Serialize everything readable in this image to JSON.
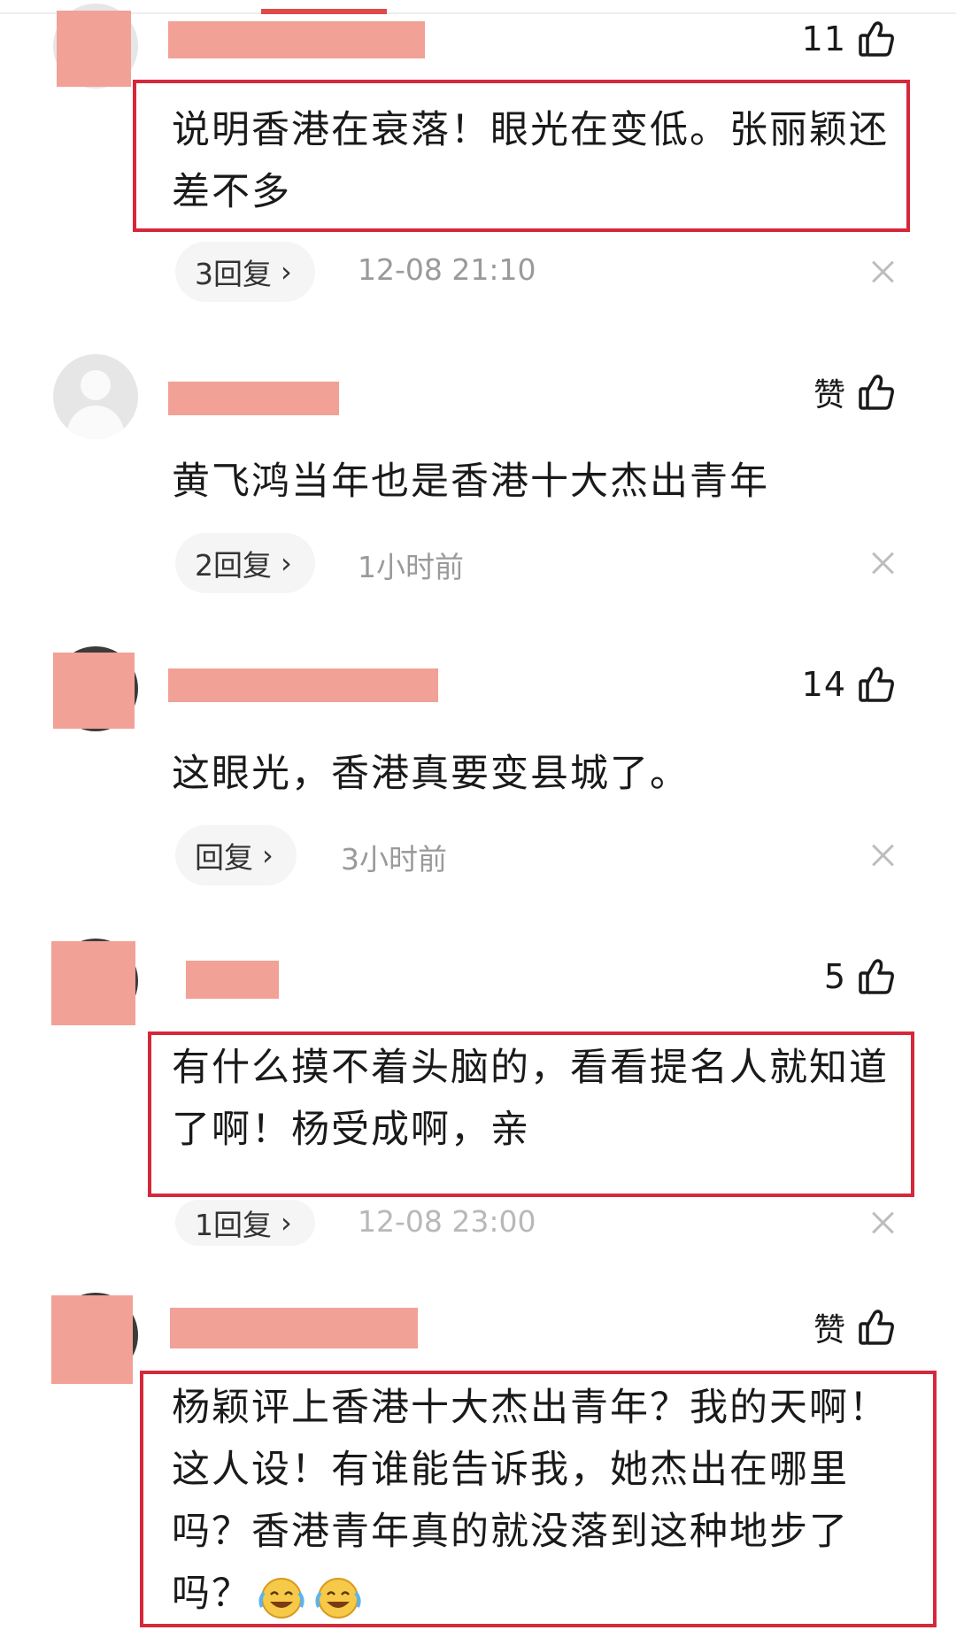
{
  "comments": [
    {
      "likes": "11",
      "text": "说明香港在衰落！眼光在变低。张丽颖还差不多",
      "reply_label": "3回复",
      "time": "12-08 21:10",
      "highlighted": true
    },
    {
      "likes": "赞",
      "text": "黄飞鸿当年也是香港十大杰出青年",
      "reply_label": "2回复",
      "time": "1小时前",
      "highlighted": false
    },
    {
      "likes": "14",
      "text": "这眼光，香港真要变县城了。",
      "reply_label": "回复",
      "time": "3小时前",
      "highlighted": false
    },
    {
      "likes": "5",
      "text": "有什么摸不着头脑的，看看提名人就知道了啊！杨受成啊，亲",
      "reply_label": "1回复",
      "time": "12-08 23:00",
      "highlighted": true
    },
    {
      "likes": "赞",
      "text": "杨颖评上香港十大杰出青年？我的天啊！这人设！有谁能告诉我，她杰出在哪里吗？香港青年真的就没落到这种地步了吗？",
      "highlighted": true
    }
  ],
  "icons": {
    "like": "thumbs-up-icon",
    "close": "close-icon",
    "chevron": "chevron-right-icon",
    "emoji": "crying-laughing-emoji"
  },
  "colors": {
    "highlight_border": "#d6283a",
    "censor_block": "#f2a196",
    "tab_indicator": "#e04a4a"
  }
}
